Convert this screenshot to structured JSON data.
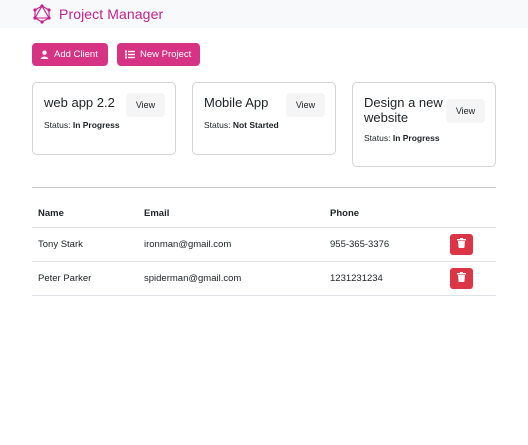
{
  "navbar": {
    "brand": "Project Manager"
  },
  "actions": {
    "add_client": "Add Client",
    "new_project": "New Project"
  },
  "projects": [
    {
      "title": "web app 2.2",
      "status_label": "Status:",
      "status": "In Progress",
      "view": "View"
    },
    {
      "title": "Mobile App",
      "status_label": "Status:",
      "status": "Not Started",
      "view": "View"
    },
    {
      "title_line1": "Design a new",
      "title_line2": "website",
      "status_label": "Status:",
      "status": "In Progress",
      "view": "View"
    }
  ],
  "clients": {
    "headers": [
      "Name",
      "Email",
      "Phone"
    ],
    "rows": [
      {
        "name": "Tony Stark",
        "email": "ironman@gmail.com",
        "phone": "955-365-3376"
      },
      {
        "name": "Peter Parker",
        "email": "spiderman@gmail.com",
        "phone": "1231231234"
      }
    ]
  },
  "colors": {
    "brand": "#c41f8f",
    "primary": "#d63384",
    "danger": "#dc3545"
  }
}
